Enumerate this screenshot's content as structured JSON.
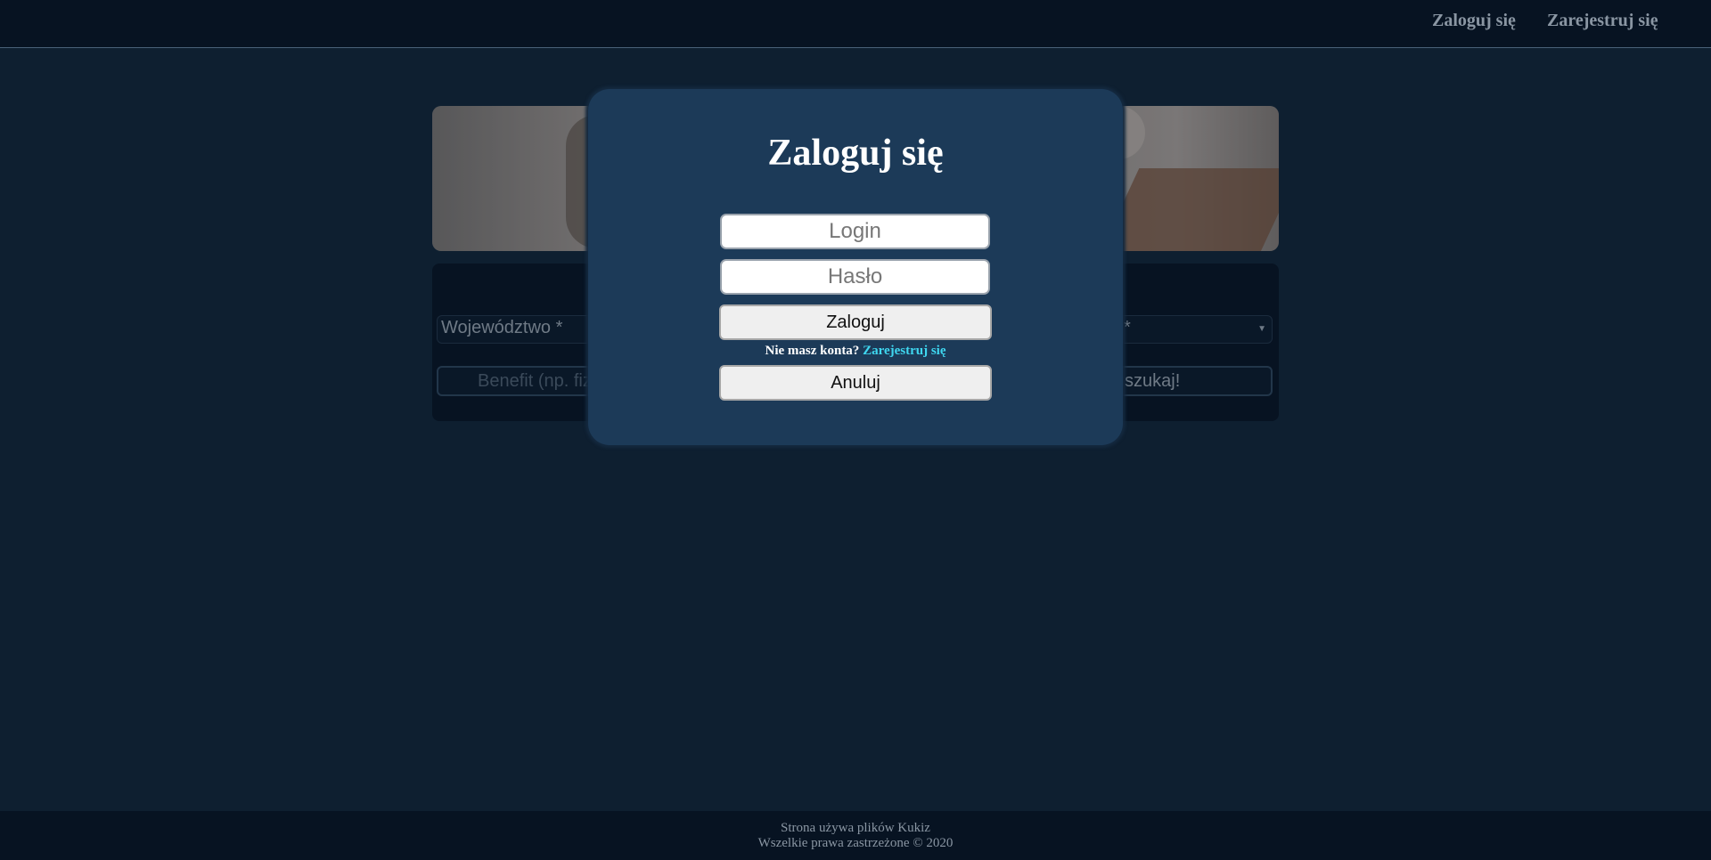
{
  "nav": {
    "login_label": "Zaloguj się",
    "register_label": "Zarejestruj się"
  },
  "search": {
    "region_placeholder": "Województwo *",
    "second_select_placeholder": "*",
    "benefit_placeholder": "Benefit (np. fiz",
    "search_button_label": "szukaj!"
  },
  "modal": {
    "title": "Zaloguj się",
    "login_placeholder": "Login",
    "password_placeholder": "Hasło",
    "login_button_label": "Zaloguj",
    "no_account_text": "Nie masz konta?",
    "register_link_label": "Zarejestruj się",
    "cancel_button_label": "Anuluj"
  },
  "footer": {
    "cookies_text": "Strona używa plików Kukiz",
    "copyright_text": "Wszelkie prawa zastrzeżone © 2020"
  },
  "colors": {
    "background": "#0e1f30",
    "bar": "#071322",
    "modal": "#1c3a58",
    "link_accent": "#3fd7f0"
  }
}
